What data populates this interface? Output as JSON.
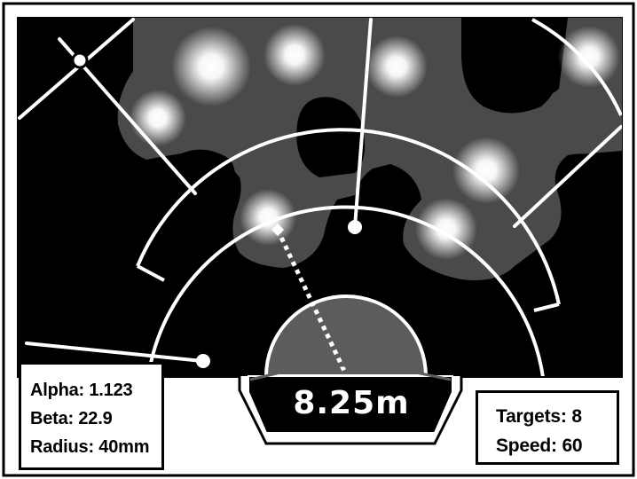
{
  "stats": {
    "alpha": "Alpha: 1.123",
    "beta": "Beta: 22.9",
    "radius": "Radius: 40mm",
    "targets": "Targets: 8",
    "speed": "Speed: 60"
  },
  "distance_readout": "8.25m",
  "colors": {
    "background": "#000000",
    "scanned_region": "#4a4a4a",
    "target_glow": "#ffffff",
    "hud_lines": "#ffffff",
    "panel_fill": "#ffffff",
    "panel_text": "#000000",
    "dome": "#5c5c5c"
  }
}
